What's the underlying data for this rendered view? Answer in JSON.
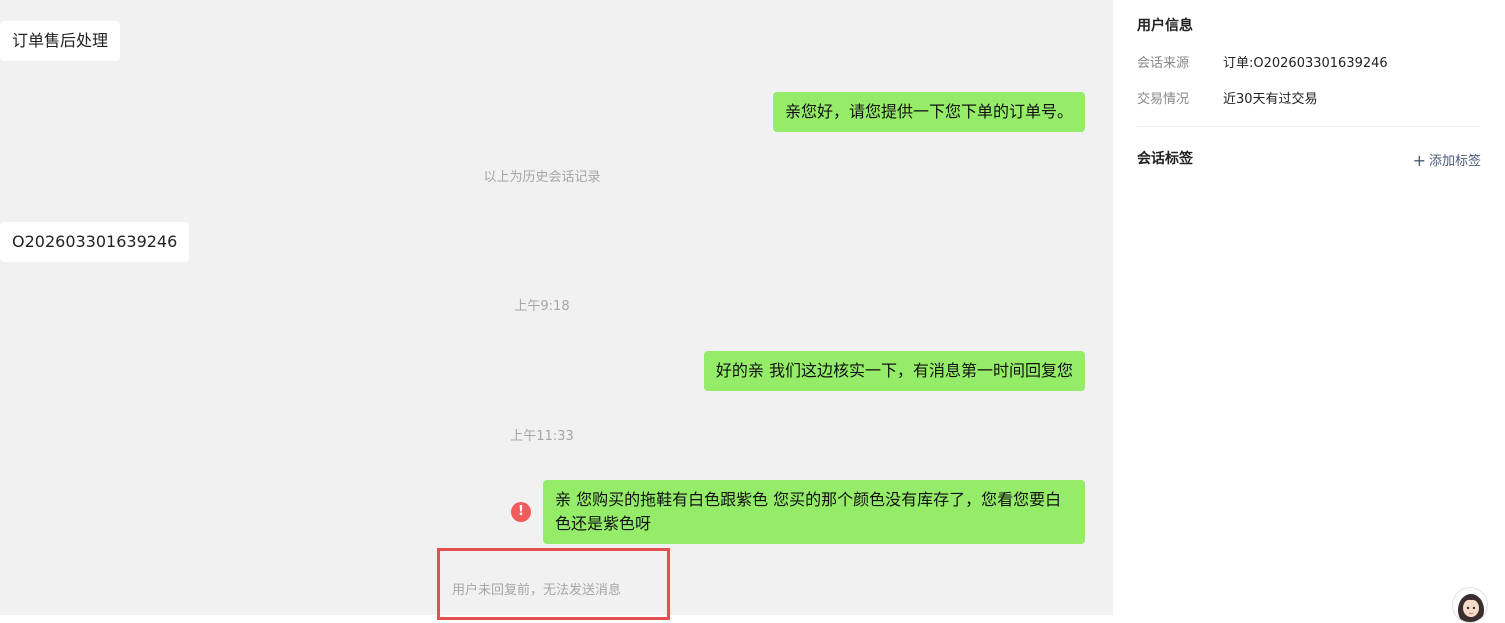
{
  "chat": {
    "messages": [
      {
        "text": "订单售后处理"
      },
      {
        "text": "亲您好，请您提供一下您下单的订单号。"
      },
      {
        "text": "以上为历史会话记录"
      },
      {
        "text": "O202603301639246"
      },
      {
        "text": "上午9:18"
      },
      {
        "text": "好的亲 我们这边核实一下，有消息第一时间回复您"
      },
      {
        "text": "上午11:33"
      },
      {
        "text": "亲 您购买的拖鞋有白色跟紫色 您买的那个颜色没有库存了，您看您要白色还是紫色呀"
      }
    ],
    "error_symbol": "!",
    "notice": "用户未回复前，无法发送消息"
  },
  "panel": {
    "user_info_title": "用户信息",
    "rows": [
      {
        "label": "会话来源",
        "value": "订单:O202603301639246"
      },
      {
        "label": "交易情况",
        "value": "近30天有过交易"
      }
    ],
    "tags_title": "会话标签",
    "add_tag_label": "添加标签"
  },
  "colors": {
    "sent_bubble": "#95ec69",
    "received_bubble": "#ffffff",
    "chat_background": "#f1f1f1",
    "error": "#f25b5b",
    "highlight_border": "#e35050"
  },
  "icons": {
    "error": "alert-circle-icon",
    "add": "plus-icon"
  }
}
